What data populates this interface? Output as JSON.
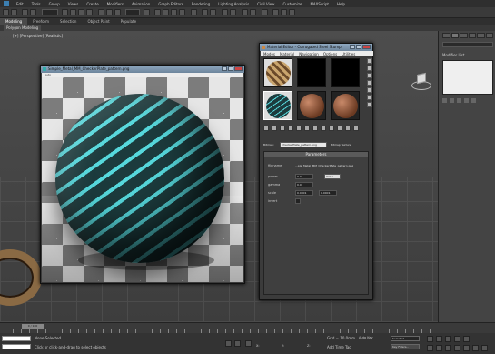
{
  "menubar": {
    "items": [
      "Edit",
      "Tools",
      "Group",
      "Views",
      "Create",
      "Modifiers",
      "Animation",
      "Graph Editors",
      "Rendering",
      "Lighting Analysis",
      "Civil View",
      "Customize",
      "MAXScript",
      "Help"
    ]
  },
  "ribbon": {
    "tabs": [
      "Modeling",
      "Freeform",
      "Selection",
      "Object Paint",
      "Populate"
    ],
    "sub_label": "Polygon Modeling"
  },
  "viewport": {
    "label": "[+] [Perspective] [Realistic]"
  },
  "command_panel": {
    "modifier_list_label": "Modifier List"
  },
  "render_window": {
    "title": "Simple_Metal_MM_CheckerPlate_pattern.png",
    "bar_label": "Auto"
  },
  "material_editor": {
    "title": "Material Editor - Corrugated Steel Stump",
    "menus": [
      "Modes",
      "Material",
      "Navigation",
      "Options",
      "Utilities"
    ],
    "map_label": "Bitmap:",
    "map_name": "CheckerPlate_pattern.png",
    "map_type": "Bitmap Texture",
    "params_header": "Parameters",
    "filename_label": "filename",
    "filename_value": "...ple_Metal_MM_CheckerPlate_pattern.png",
    "rows": [
      {
        "label": "power",
        "value": "0.0",
        "extra": "Value",
        "type": "button"
      },
      {
        "label": "gamma",
        "value": "0.0",
        "extra": "",
        "type": "none"
      },
      {
        "label": "scale",
        "value": "0.0001",
        "extra": "0.0001",
        "type": "second"
      },
      {
        "label": "invert",
        "value": "",
        "extra": "",
        "type": "none"
      }
    ]
  },
  "timeline": {
    "slider": "0 / 100"
  },
  "status": {
    "selection": "None Selected",
    "hint": "Click or click-and-drag to select objects",
    "grid": "Grid = 10.0mm",
    "add_time_tag": "Add Time Tag",
    "auto_key": "Auto Key",
    "selected": "Selected",
    "key_filters": "Key Filters..."
  }
}
